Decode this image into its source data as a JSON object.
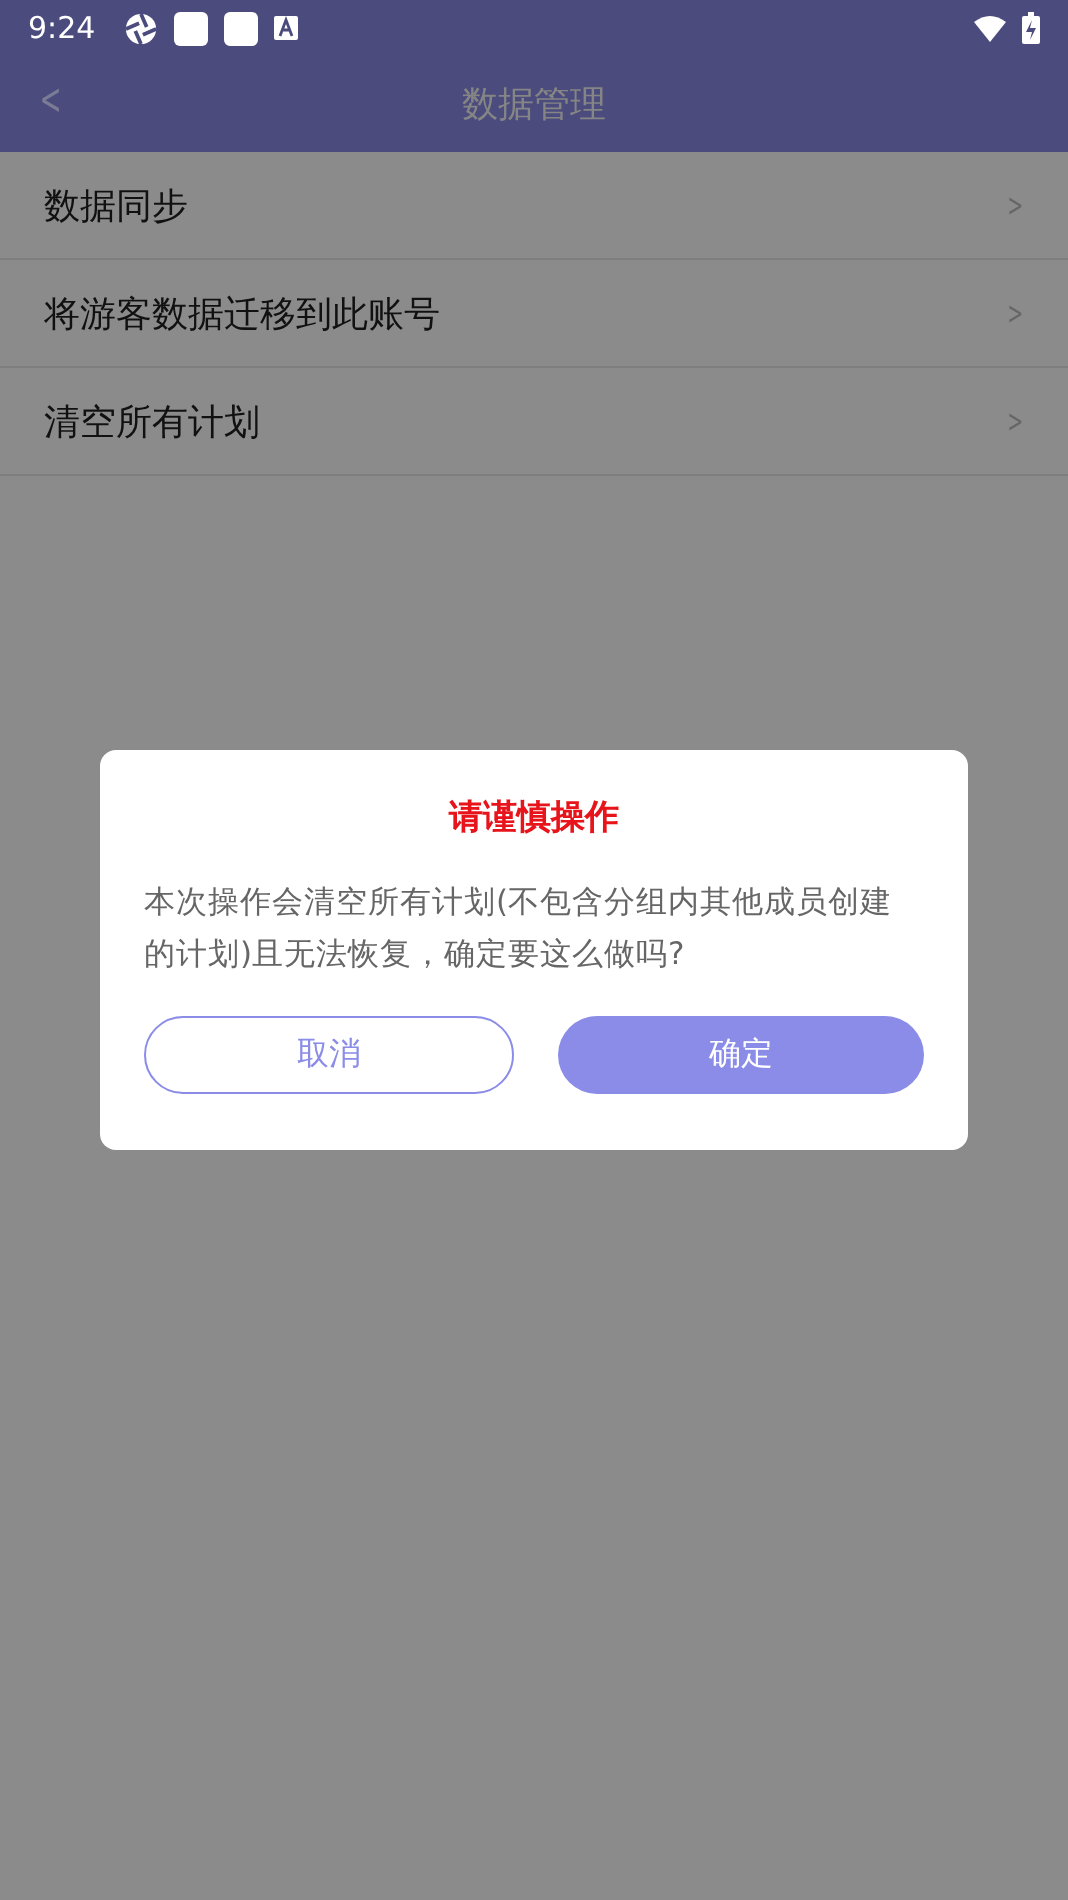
{
  "status_bar": {
    "time": "9:24"
  },
  "header": {
    "back": "<",
    "title": "数据管理"
  },
  "menu": [
    {
      "label": "数据同步",
      "chevron": ">"
    },
    {
      "label": "将游客数据迁移到此账号",
      "chevron": ">"
    },
    {
      "label": "清空所有计划",
      "chevron": ">"
    }
  ],
  "dialog": {
    "title": "请谨慎操作",
    "message": "本次操作会清空所有计划(不包含分组内其他成员创建的计划)且无法恢复，确定要这么做吗?",
    "buttons": [
      {
        "label": "取消",
        "kind": "outline"
      },
      {
        "label": "确定",
        "kind": "filled"
      }
    ]
  }
}
